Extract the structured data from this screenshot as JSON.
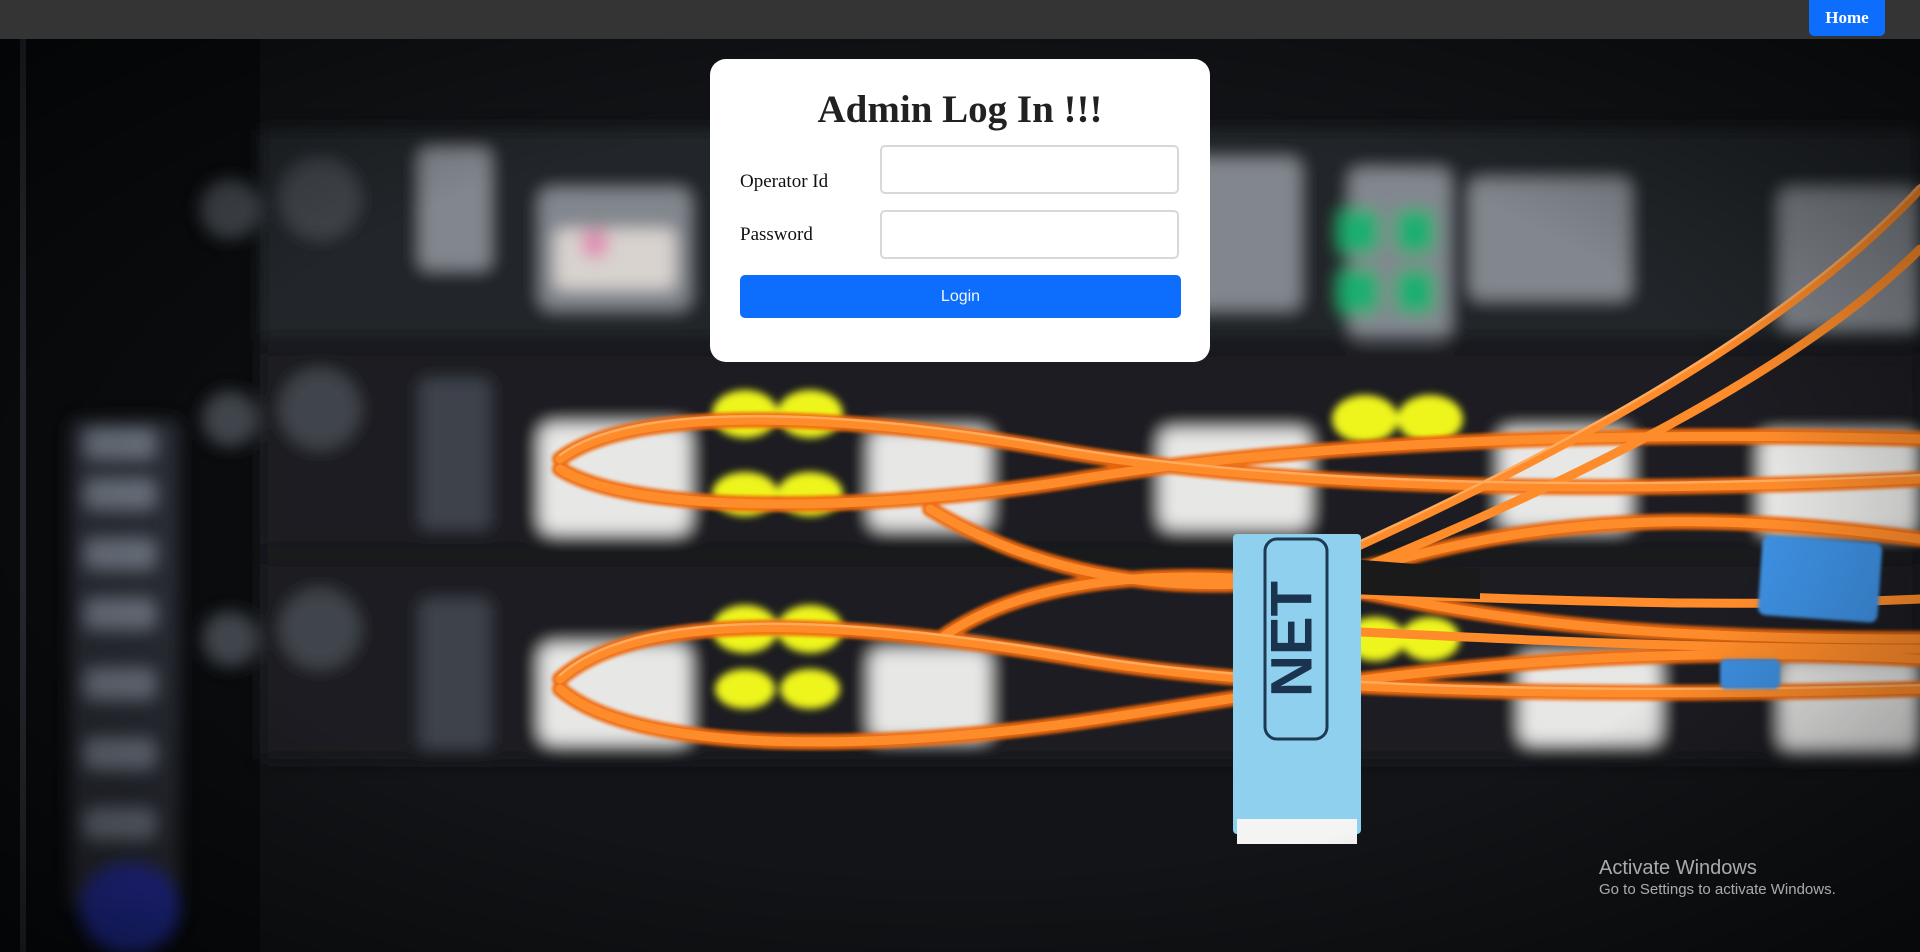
{
  "navbar": {
    "home_label": "Home"
  },
  "login": {
    "title": "Admin Log In !!!",
    "operator_label": "Operator Id",
    "operator_value": "",
    "password_label": "Password",
    "password_value": "",
    "button_label": "Login"
  },
  "watermark": {
    "title": "Activate Windows",
    "subtitle": "Go to Settings to activate Windows."
  },
  "colors": {
    "navbar": "#343434",
    "accent": "#0d6efd",
    "card": "#ffffff",
    "cable": "#ff7a18",
    "led": "#e9f51a",
    "tag": "#8fd0ee"
  }
}
